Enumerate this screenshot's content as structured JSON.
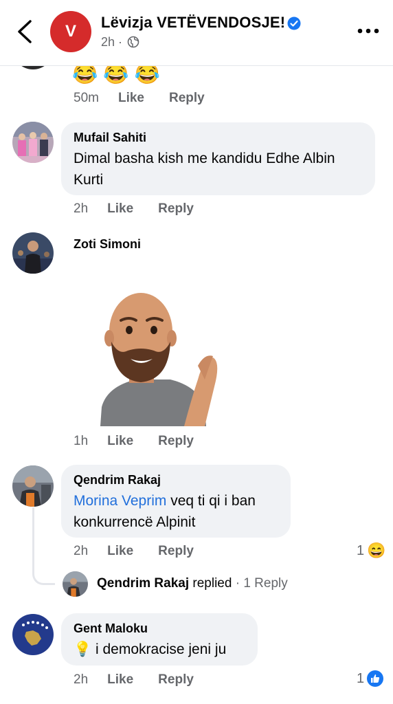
{
  "header": {
    "page_name": "Lëvizja VETËVENDOSJE!",
    "avatar_letter": "V",
    "time": "2h",
    "separator": "·"
  },
  "top_fragment": {
    "emojis": "😂😂😂",
    "time": "50m",
    "like": "Like",
    "reply": "Reply"
  },
  "comments": [
    {
      "author": "Mufail Sahiti",
      "text": "Dimal basha kish me kandidu Edhe Albin Kurti",
      "time": "2h",
      "like": "Like",
      "reply": "Reply"
    },
    {
      "author": "Zoti Simoni",
      "sticker": "bearded-avatar-clapping",
      "time": "1h",
      "like": "Like",
      "reply": "Reply"
    },
    {
      "author": "Qendrim Rakaj",
      "mention": "Morina Veprim",
      "text": " veq ti qi i ban konkurrencë Alpinit",
      "time": "2h",
      "like": "Like",
      "reply": "Reply",
      "reaction_count": "1",
      "reaction_emoji": "😄",
      "reply_author": "Qendrim Rakaj",
      "reply_verb": "replied",
      "reply_sep": " · ",
      "reply_count": "1 Reply"
    },
    {
      "author": "Gent Maloku",
      "emoji": "💡",
      "text": " i demokracise jeni ju",
      "time": "2h",
      "like": "Like",
      "reply": "Reply",
      "reaction_count": "1",
      "reaction_icon": "thumbs-up-icon",
      "reaction_color": "#1877f2"
    }
  ],
  "colors": {
    "accent": "#1877f2",
    "brand_red": "#d52b2b",
    "bubble": "#f0f2f5",
    "muted": "#65676b"
  }
}
